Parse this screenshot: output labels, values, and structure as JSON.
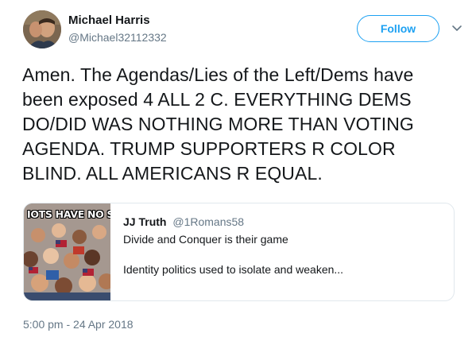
{
  "tweet": {
    "author": {
      "name": "Michael Harris",
      "handle": "@Michael32112332"
    },
    "follow_label": "Follow",
    "text": "Amen. The Agendas/Lies of the Left/Dems have been exposed 4 ALL 2 C. EVERYTHING DEMS DO/DID WAS NOTHING MORE THAN VOTING AGENDA. TRUMP SUPPORTERS R COLOR BLIND. ALL AMERICANS R EQUAL.",
    "timestamp": "5:00 pm - 24 Apr 2018"
  },
  "quoted_tweet": {
    "image_caption": "IOTS HAVE NO SKIN",
    "author_name": "JJ Truth",
    "author_handle": "@1Romans58",
    "line1": "Divide and Conquer is their game",
    "line2": "Identity politics used to isolate and weaken..."
  },
  "icons": {
    "caret": "chevron-down-icon"
  },
  "colors": {
    "accent": "#1da1f2",
    "secondary_text": "#657786",
    "border": "#e1e8ed"
  }
}
